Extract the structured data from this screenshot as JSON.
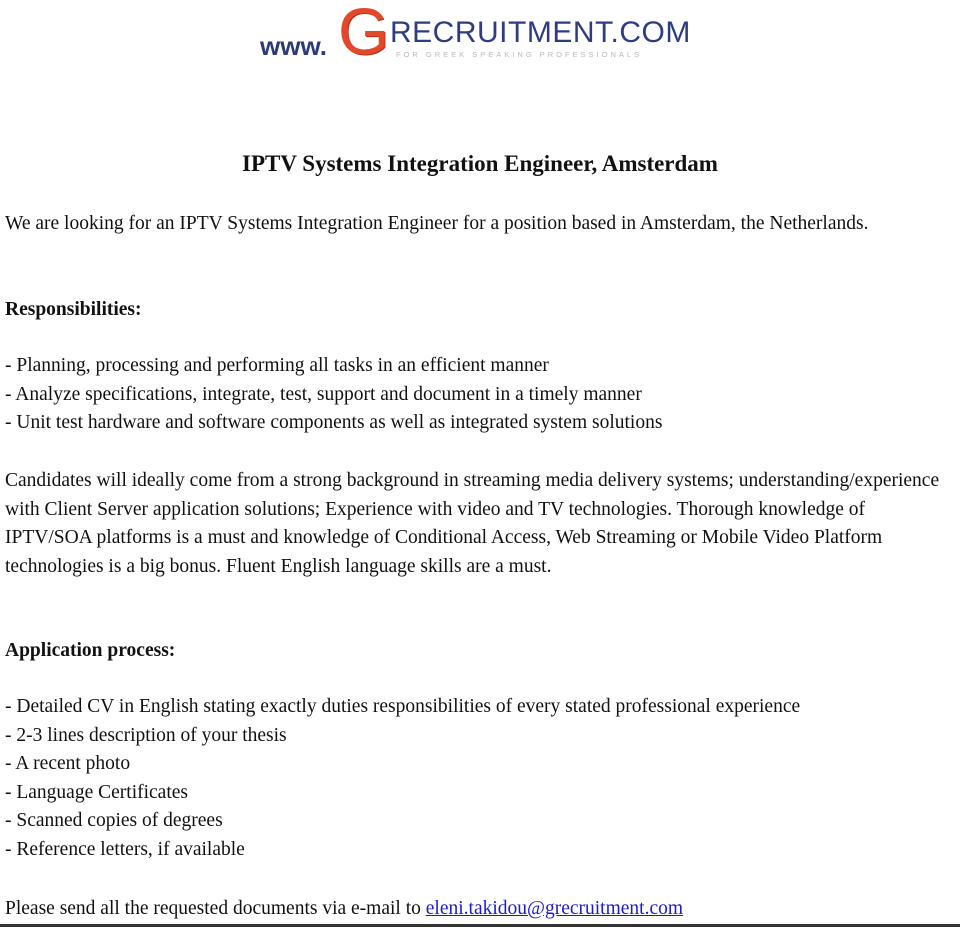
{
  "logo": {
    "prefix": "www.",
    "big_letter": "G",
    "rest": "RECRUITMENT.COM",
    "tagline": "FOR GREEK SPEAKING PROFESSIONALS",
    "colors": {
      "navy": "#2d3d80",
      "orange": "#e2482a",
      "tagline": "#b8b8b8"
    }
  },
  "document": {
    "title": "IPTV Systems Integration Engineer, Amsterdam",
    "intro": "We are looking for an IPTV Systems Integration Engineer for a position based in Amsterdam, the Netherlands.",
    "responsibilities": {
      "heading": "Responsibilities:",
      "items": [
        "- Planning, processing and performing all tasks in an efficient manner",
        "- Analyze specifications, integrate, test, support and document in a timely manner",
        "- Unit test hardware and software components as well as integrated system solutions"
      ]
    },
    "candidates": "Candidates will ideally come from a strong background in streaming media delivery systems; understanding/experience with Client Server application solutions; Experience with video and TV technologies. Thorough knowledge of IPTV/SOA platforms is a must and knowledge of Conditional Access, Web Streaming or Mobile Video Platform technologies is a big bonus. Fluent English language skills are a must.",
    "application": {
      "heading": "Application process:",
      "items": [
        "- Detailed CV in English stating exactly duties responsibilities of every stated professional experience",
        "- 2-3 lines description of your thesis",
        "- A recent photo",
        "- Language Certificates",
        "- Scanned copies of degrees",
        "- Reference letters, if available"
      ]
    },
    "closing": {
      "text": "Please send all the requested documents via e-mail to ",
      "email": "eleni.takidou@grecruitment.com",
      "link_color": "#1a1ad0"
    }
  }
}
